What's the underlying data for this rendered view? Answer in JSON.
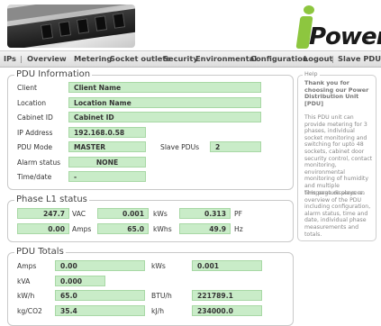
{
  "nav": {
    "items": [
      "IPs",
      "Overview",
      "Metering",
      "Socket outlets",
      "Security",
      "Environmental",
      "Configuration",
      "Logout",
      "Slave PDUs"
    ]
  },
  "logo": {
    "letter": "Power",
    "reg": "®"
  },
  "pdu_info": {
    "legend": "PDU Information",
    "client_label": "Client",
    "client_value": "Client Name",
    "location_label": "Location",
    "location_value": "Location Name",
    "cabinet_label": "Cabinet ID",
    "cabinet_value": "Cabinet ID",
    "ip_label": "IP Address",
    "ip_value": "192.168.0.58",
    "mode_label": "PDU Mode",
    "mode_value": "MASTER",
    "slave_label": "Slave PDUs",
    "slave_value": "2",
    "alarm_label": "Alarm status",
    "alarm_value": "NONE",
    "time_label": "Time/date",
    "time_value": "-"
  },
  "phase": {
    "legend": "Phase L1 status",
    "vac_value": "247.7",
    "vac_unit": "VAC",
    "kws_value": "0.001",
    "kws_unit": "kWs",
    "pf_value": "0.313",
    "pf_unit": "PF",
    "amps_value": "0.00",
    "amps_unit": "Amps",
    "kwhs_value": "65.0",
    "kwhs_unit": "kWhs",
    "hz_value": "49.9",
    "hz_unit": "Hz"
  },
  "totals": {
    "legend": "PDU Totals",
    "amps_label": "Amps",
    "amps_value": "0.00",
    "kws_label": "kWs",
    "kws_value": "0.001",
    "kva_label": "kVA",
    "kva_value": "0.000",
    "kwh_label": "kW/h",
    "kwh_value": "65.0",
    "btu_label": "BTU/h",
    "btu_value": "221789.1",
    "co2_label": "kg/CO2",
    "co2_value": "35.4",
    "kj_label": "kJ/h",
    "kj_value": "234000.0"
  },
  "help": {
    "legend": "Help",
    "title": "Thank you for choosing our Power Distribution Unit [PDU]",
    "p1": "This PDU unit can provide metering for 3 phases, individual socket monitoring and switching for upto 48 sockets, cabinet door security control, contact monitoring, environmental monitoring of humidity and multiple temperature sensors.",
    "p2": "This page displays an overview of the PDU including configuration, alarm status, time and date, individual phase measurements and totals."
  }
}
